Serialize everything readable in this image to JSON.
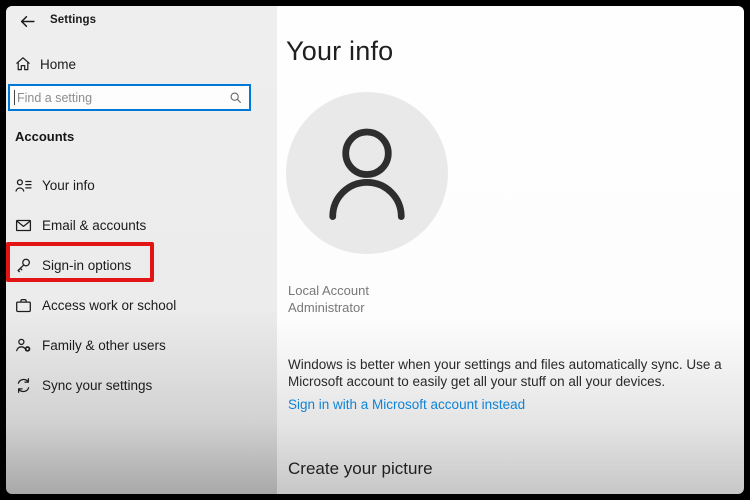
{
  "window": {
    "title": "Settings"
  },
  "sidebar": {
    "home_label": "Home",
    "search_placeholder": "Find a setting",
    "section_header": "Accounts",
    "items": [
      {
        "label": "Your info",
        "icon": "your-info-icon",
        "highlighted": false
      },
      {
        "label": "Email & accounts",
        "icon": "email-icon",
        "highlighted": false
      },
      {
        "label": "Sign-in options",
        "icon": "key-icon",
        "highlighted": true
      },
      {
        "label": "Access work or school",
        "icon": "briefcase-icon",
        "highlighted": false
      },
      {
        "label": "Family & other users",
        "icon": "family-icon",
        "highlighted": false
      },
      {
        "label": "Sync your settings",
        "icon": "sync-icon",
        "highlighted": false
      }
    ]
  },
  "main": {
    "page_title": "Your info",
    "account_name": "Local Account",
    "account_role": "Administrator",
    "sync_description": "Windows is better when your settings and files automatically sync. Use a Microsoft account to easily get all your stuff on all your devices.",
    "signin_link_label": "Sign in with a Microsoft account instead",
    "section_title": "Create your picture"
  },
  "colors": {
    "accent": "#0078d7",
    "link_blue": "#0f83d6",
    "annotation_red": "#e31414",
    "sidebar_bg": "#ececec",
    "avatar_bg": "#e9e9e9"
  }
}
